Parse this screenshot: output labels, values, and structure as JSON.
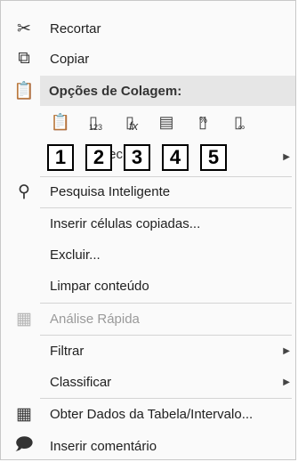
{
  "menu": {
    "items": [
      {
        "icon": "scissors-icon",
        "label": "Recortar"
      },
      {
        "icon": "copy-icon",
        "label": "Copiar"
      }
    ],
    "paste_options": {
      "header": "Opções de Colagem:",
      "buttons": [
        {
          "icon": "paste-icon",
          "sub": ""
        },
        {
          "icon": "paste-values-icon",
          "sub": "123"
        },
        {
          "icon": "paste-formulas-icon",
          "sub": "fx"
        },
        {
          "icon": "paste-transpose-icon",
          "sub": ""
        },
        {
          "icon": "paste-formatting-icon",
          "sub": "%"
        },
        {
          "icon": "paste-link-icon",
          "sub": ""
        }
      ],
      "numbers": [
        "1",
        "2",
        "3",
        "4",
        "5"
      ],
      "special_fragment": "r ec"
    },
    "lower_items": [
      {
        "icon": "smart-lookup-icon",
        "label": "Pesquisa Inteligente"
      },
      {
        "icon": "",
        "label": "Inserir células copiadas..."
      },
      {
        "icon": "",
        "label": "Excluir..."
      },
      {
        "icon": "",
        "label": "Limpar conteúdo"
      },
      {
        "icon": "quick-analysis-icon",
        "label": "Análise Rápida",
        "disabled": true
      },
      {
        "icon": "",
        "label": "Filtrar",
        "submenu": true
      },
      {
        "icon": "",
        "label": "Classificar",
        "submenu": true
      },
      {
        "icon": "table-icon",
        "label": "Obter Dados da Tabela/Intervalo..."
      },
      {
        "icon": "comment-icon",
        "label": "Inserir comentário"
      }
    ]
  }
}
